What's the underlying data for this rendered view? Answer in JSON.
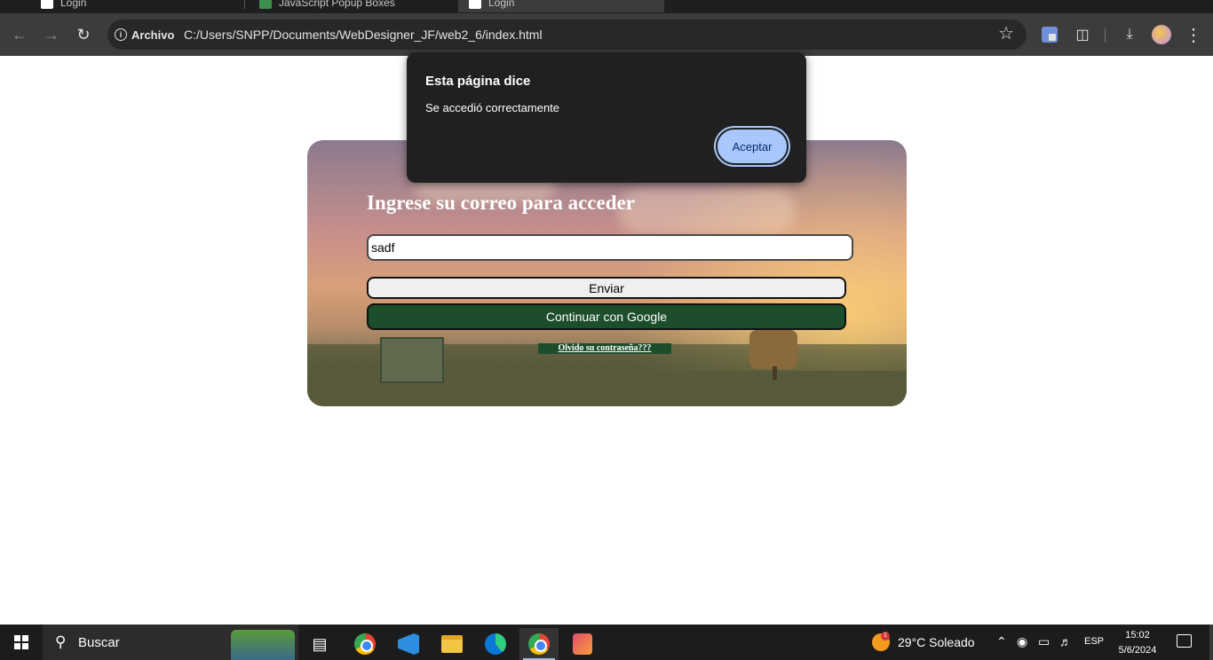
{
  "browser": {
    "tabs": [
      {
        "label": "Login",
        "active": false
      },
      {
        "label": "JavaScript Popup Boxes",
        "active": false
      },
      {
        "label": "Login",
        "active": true
      }
    ],
    "site_chip": "Archivo",
    "url": "C:/Users/SNPP/Documents/WebDesigner_JF/web2_6/index.html"
  },
  "page": {
    "heading": "Ingrese su correo para acceder",
    "email_value": "sadf",
    "send_label": "Enviar",
    "google_label": "Continuar con Google",
    "forgot_label": "Olvido su contraseña???"
  },
  "dialog": {
    "title": "Esta página dice",
    "message": "Se accedió correctamente",
    "ok_label": "Aceptar"
  },
  "taskbar": {
    "search_label": "Buscar",
    "weather_temp": "29°C",
    "weather_desc": "Soleado",
    "weather_badge": "1",
    "language": "ESP",
    "time": "15:02",
    "date": "5/6/2024"
  },
  "colors": {
    "dialog_bg": "#202020",
    "dialog_button": "#a8c7fa",
    "google_button": "#1d4e2c",
    "toolbar": "#3c3c3c"
  }
}
